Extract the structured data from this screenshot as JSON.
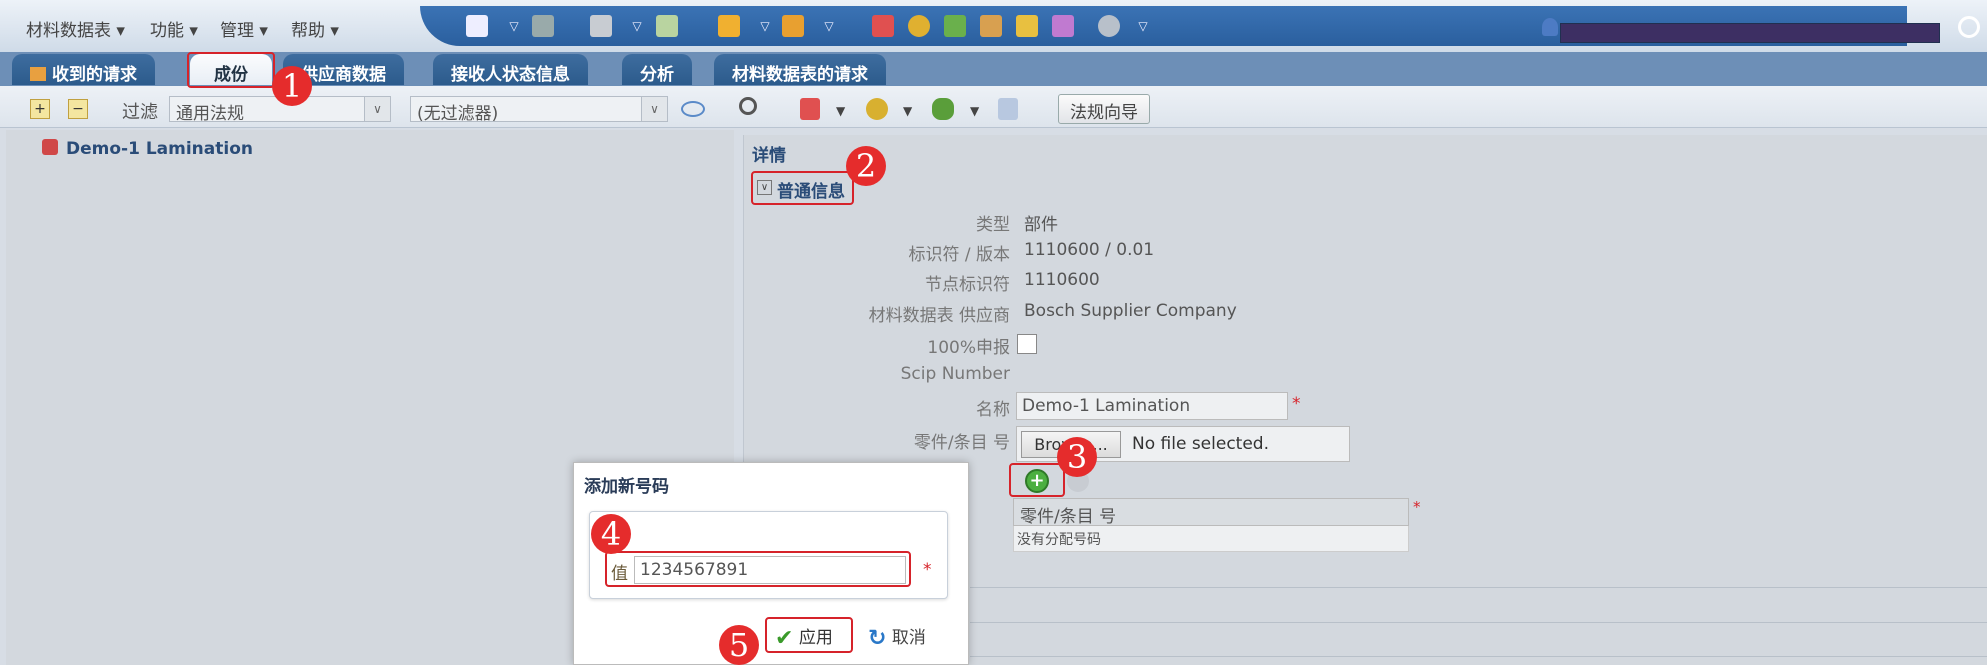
{
  "menu": {
    "materials_sheet": "材料数据表 ▾",
    "functions": "功能 ▾",
    "manage": "管理 ▾",
    "help": "帮助 ▾"
  },
  "tabs": [
    {
      "label": "收到的请求"
    },
    {
      "label": "成份"
    },
    {
      "label": "供应商数据"
    },
    {
      "label": "接收人状态信息"
    },
    {
      "label": "分析"
    },
    {
      "label": "材料数据表的请求"
    }
  ],
  "filter": {
    "label": "过滤",
    "regulation": "通用法规",
    "no_filter": "(无过滤器)",
    "wizard": "法规向导"
  },
  "tree": {
    "root": "Demo-1 Lamination"
  },
  "details": {
    "title": "详情",
    "section": "普通信息",
    "fields": [
      {
        "label": "类型",
        "value": "部件"
      },
      {
        "label": "标识符 / 版本",
        "value": "1110600 / 0.01"
      },
      {
        "label": "节点标识符",
        "value": "1110600"
      },
      {
        "label": "材料数据表 供应商",
        "value": "Bosch Supplier Company"
      },
      {
        "label": "100%申报",
        "value": ""
      },
      {
        "label": "Scip Number",
        "value": ""
      },
      {
        "label": "名称",
        "value": "Demo-1 Lamination"
      },
      {
        "label": "零件/条目 号",
        "value": ""
      }
    ],
    "browse_button": "Browse...",
    "no_file": "No file selected.",
    "table_header": "零件/条目 号",
    "empty_text": "没有分配号码",
    "required": "*"
  },
  "dialog": {
    "title": "添加新号码",
    "value_label": "值",
    "value": "1234567891",
    "apply": "应用",
    "cancel": "取消"
  },
  "steps": [
    "1",
    "2",
    "3",
    "4",
    "5"
  ],
  "colors": {
    "accent_blue": "#2a5f9e",
    "marker_red": "#e52c2c"
  }
}
